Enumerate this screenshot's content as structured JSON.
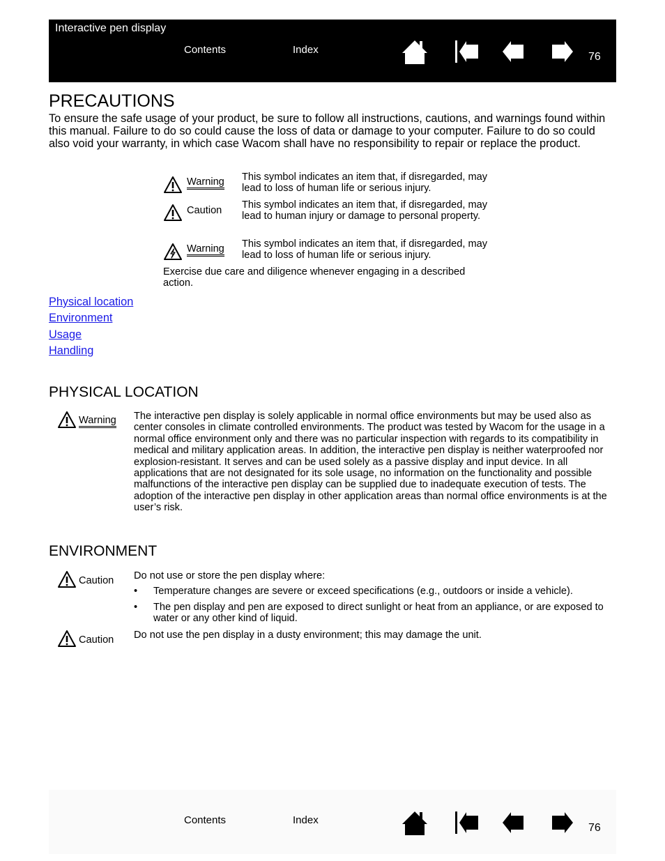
{
  "header": {
    "doc_title": "Interactive pen display",
    "contents_label": "Contents",
    "index_label": "Index",
    "page_number": "76",
    "icons": [
      "home-icon",
      "first-page-icon",
      "previous-page-icon",
      "next-page-icon"
    ]
  },
  "main": {
    "title": "PRECAUTIONS",
    "intro": "To ensure the safe usage of your product, be sure to follow all instructions, cautions, and warnings found within this manual.  Failure to do so could cause the loss of data or damage to your computer.  Failure to do so could also void your warranty, in which case Wacom shall have no responsibility to repair or replace the product.",
    "symbols": [
      {
        "icon": "warning-triangle-icon",
        "label": "Warning",
        "description": "This symbol indicates an item that, if disregarded, may lead to loss of human life or serious injury."
      },
      {
        "icon": "caution-triangle-icon",
        "label": "Caution",
        "description": "This symbol indicates an item that, if disregarded, may lead to human injury or damage to personal property."
      },
      {
        "icon": "electric-shock-warning-icon",
        "label": "Warning",
        "description": "This symbol indicates an item that, if disregarded, may lead to loss of human life or serious injury."
      }
    ],
    "symbols_note": "Exercise due care and diligence whenever engaging in a described action.",
    "links": [
      "Physical location",
      "Environment",
      "Usage",
      "Handling"
    ],
    "link_color": "#1a1ae6",
    "physical_location": {
      "heading": "PHYSICAL LOCATION",
      "label": "Warning",
      "text": "The interactive pen display is solely applicable in normal office environments but may be used also as center consoles in climate controlled environments.  The product was tested by Wacom for the usage in a normal office environment only and there was no particular inspection with regards to its compatibility in medical and military application areas.  In addition, the interactive pen display is neither waterproofed nor explosion-resistant.  It serves and can be used solely as a passive display and input device.  In all applications that are not designated for its sole usage, no information on the functionality and possible malfunctions of the interactive pen display can be supplied due to inadequate execution of tests.  The adoption of the interactive pen display in other application areas than normal office environments is at the user’s risk."
    },
    "environment": {
      "heading": "ENVIRONMENT",
      "notices": [
        {
          "label": "Caution",
          "text": "Do not use or store the pen display where:",
          "bullets": [
            "Temperature changes are severe or exceed specifications (e.g., outdoors or inside a vehicle).",
            "The pen display and pen are exposed to direct sunlight or heat from an appliance, or are exposed to water or any other kind of liquid."
          ]
        },
        {
          "label": "Caution",
          "text": "Do not use the pen display in a dusty environment; this may damage the unit."
        }
      ]
    }
  },
  "footer": {
    "contents_label": "Contents",
    "index_label": "Index",
    "page_number": "76"
  }
}
